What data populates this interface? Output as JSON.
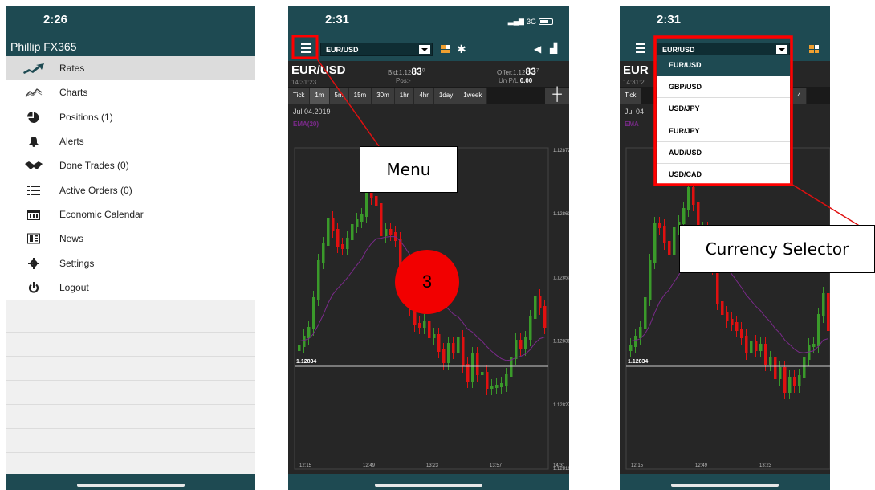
{
  "phones": {
    "menu_screen": {
      "time": "2:26",
      "app_title": "Phillip FX365",
      "items": [
        {
          "label": "Rates",
          "icon": "rates-icon"
        },
        {
          "label": "Charts",
          "icon": "charts-icon"
        },
        {
          "label": "Positions (1)",
          "icon": "positions-icon"
        },
        {
          "label": "Alerts",
          "icon": "bell-icon"
        },
        {
          "label": "Done Trades (0)",
          "icon": "handshake-icon"
        },
        {
          "label": "Active Orders (0)",
          "icon": "list-icon"
        },
        {
          "label": "Economic Calendar",
          "icon": "calendar-icon"
        },
        {
          "label": "News",
          "icon": "newspaper-icon"
        },
        {
          "label": "Settings",
          "icon": "gear-icon"
        },
        {
          "label": "Logout",
          "icon": "power-icon"
        }
      ],
      "active_index": 0
    },
    "chart_screen": {
      "time": "2:31",
      "network": "3G",
      "selected_pair": "EUR/USD",
      "symbol": "EUR/USD",
      "quote_time": "14:31:23",
      "bid_label": "Bid:1.12",
      "bid_big": "83",
      "bid_sup": "0",
      "offer_label": "Offer:1.12",
      "offer_big": "83",
      "offer_sup": "7",
      "pos_label": "Pos:-",
      "pl_label": "Un P/L:",
      "pl_value": "0.00",
      "timeframes": [
        "Tick",
        "1m",
        "5m",
        "15m",
        "30m",
        "1hr",
        "4hr",
        "1day",
        "1week"
      ],
      "active_timeframe": "1m",
      "crosshair_symbol": "-|-",
      "date_label": "Jul 04.2019",
      "indicator_label": "EMA(20)",
      "price_line_label": "1.12834",
      "y_ticks": [
        "1.12872",
        "1.12861",
        "1.12850",
        "1.12838",
        "1.12827",
        "1.12816"
      ],
      "x_ticks": [
        "12:15",
        "12:49",
        "13:23",
        "13:57",
        "14:31"
      ]
    },
    "dropdown_screen": {
      "time": "2:31",
      "selected_pair": "EUR/USD",
      "symbol_partial": "EUR",
      "quote_time_partial": "14:31:2",
      "tab_tick": "Tick",
      "tab_partial_hr": "hr",
      "tab_partial_4": "4",
      "date_partial": "Jul 04",
      "indicator_partial": "EMA",
      "price_line_label": "1.12834",
      "x_ticks": [
        "12:15",
        "12:49",
        "13:23"
      ],
      "options": [
        "EUR/USD",
        "GBP/USD",
        "USD/JPY",
        "EUR/JPY",
        "AUD/USD",
        "USD/CAD"
      ],
      "selected_index": 0
    }
  },
  "annotations": {
    "menu_callout": "Menu",
    "step_badge": "3",
    "currency_callout": "Currency Selector",
    "highlight_color": "#ff0000"
  },
  "colors": {
    "app_header": "#1e4a52",
    "chart_bg": "#262626",
    "candle_up": "#3a9a2a",
    "candle_down": "#e01010",
    "ema_line": "#7a2a8a"
  }
}
